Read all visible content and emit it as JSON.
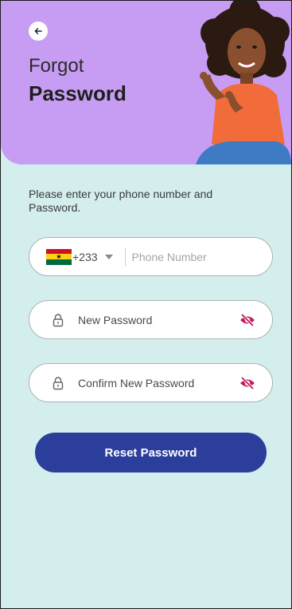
{
  "header": {
    "back_icon": "arrow-left-icon",
    "title_line1": "Forgot",
    "title_line2": "Password",
    "accent_color": "#c79df3"
  },
  "instruction": "Please enter your phone number and Password.",
  "phone": {
    "country_flag": "ghana-flag-icon",
    "dial_code": "+233",
    "placeholder": "Phone Number",
    "value": ""
  },
  "new_password": {
    "placeholder": "New Password",
    "value": "",
    "icon": "lock-icon",
    "toggle_icon": "eye-off-icon"
  },
  "confirm_password": {
    "placeholder": "Confirm New Password",
    "value": "",
    "icon": "lock-icon",
    "toggle_icon": "eye-off-icon"
  },
  "reset_button": {
    "label": "Reset Password",
    "color": "#2c3e9b"
  },
  "colors": {
    "background": "#d4eeee",
    "eye_icon": "#c2185b"
  }
}
